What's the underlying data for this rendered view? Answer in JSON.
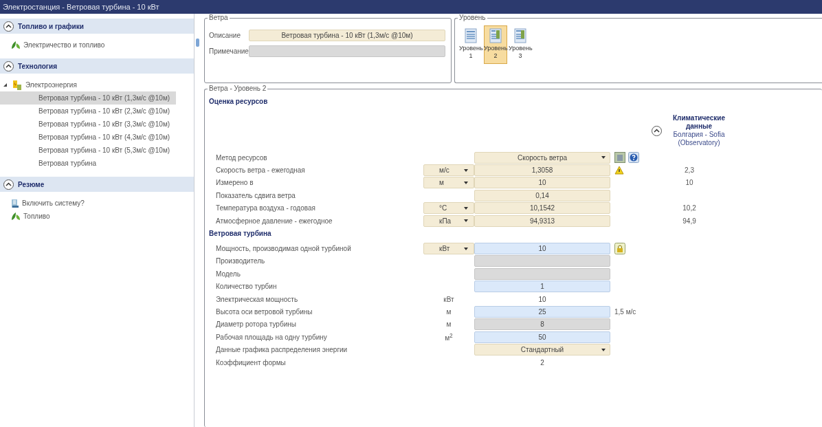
{
  "window": {
    "title": "Электростанция - Ветровая турбина - 10 кВт"
  },
  "sidebar": {
    "sections": [
      {
        "title": "Топливо и графики",
        "expanded": true,
        "items": [
          {
            "label": "Электричество и топливо",
            "kind": "fuel"
          }
        ]
      },
      {
        "title": "Технология",
        "expanded": true,
        "items": [
          {
            "label": "Электроэнергия",
            "kind": "power",
            "expanded": true,
            "children": [
              {
                "label": "Ветровая турбина - 10 кВт (1,3м/с @10м)",
                "selected": true
              },
              {
                "label": "Ветровая турбина - 10 кВт (2,3м/с @10м)",
                "selected": false
              },
              {
                "label": "Ветровая турбина - 10 кВт (3,3м/с @10м)",
                "selected": false
              },
              {
                "label": "Ветровая турбина - 10 кВт (4,3м/с @10м)",
                "selected": false
              },
              {
                "label": "Ветровая турбина - 10 кВт (5,3м/с @10м)",
                "selected": false
              },
              {
                "label": "Ветровая турбина",
                "selected": false
              }
            ]
          }
        ]
      },
      {
        "title": "Резюме",
        "expanded": true,
        "items": [
          {
            "label": "Включить систему?",
            "kind": "system"
          },
          {
            "label": "Топливо",
            "kind": "fuel"
          }
        ]
      }
    ]
  },
  "wind_group": {
    "title": "Ветра",
    "description_label": "Описание",
    "description": "Ветровая турбина - 10 кВт (1,3м/с @10м)",
    "note_label": "Примечание"
  },
  "level_group": {
    "title": "Уровень",
    "levels": [
      {
        "label": "Уровень 1",
        "selected": false
      },
      {
        "label": "Уровень 2",
        "selected": true
      },
      {
        "label": "Уровень 3",
        "selected": false
      }
    ]
  },
  "detail": {
    "title": "Ветра - Уровень 2",
    "climate": {
      "title": "Климатические данные",
      "location": "Болгария - Sofia (Observatory)",
      "expanded": true
    },
    "sections": [
      {
        "title": "Оценка ресурсов",
        "rows": [
          {
            "label": "Метод ресурсов",
            "field": {
              "kind": "select",
              "text": "Скорость ветра"
            },
            "extra": {
              "kind": "tools"
            }
          },
          {
            "label": "Скорость ветра - ежегодная",
            "unit": {
              "kind": "select",
              "text": "м/с"
            },
            "field": {
              "kind": "computed",
              "text": "1,3058"
            },
            "extra": {
              "kind": "warning"
            },
            "climate": "2,3"
          },
          {
            "label": "Измерено в",
            "unit": {
              "kind": "select",
              "text": "м"
            },
            "field": {
              "kind": "computed",
              "text": "10"
            },
            "climate": "10"
          },
          {
            "label": "Показатель сдвига ветра",
            "field": {
              "kind": "computed",
              "text": "0,14"
            }
          },
          {
            "label": "Температура воздуха - годовая",
            "unit": {
              "kind": "select",
              "text": "°C"
            },
            "field": {
              "kind": "computed",
              "text": "10,1542"
            },
            "climate": "10,2"
          },
          {
            "label": "Атмосферное давление - ежегодное",
            "unit": {
              "kind": "select",
              "text": "кПа"
            },
            "field": {
              "kind": "computed",
              "text": "94,9313"
            },
            "climate": "94,9"
          }
        ]
      },
      {
        "title": "Ветровая турбина",
        "rows": [
          {
            "label": "Мощность, производимая одной турбиной",
            "unit": {
              "kind": "select",
              "text": "кВт"
            },
            "field": {
              "kind": "input",
              "text": "10"
            },
            "extra": {
              "kind": "lock"
            }
          },
          {
            "label": "Производитель",
            "field": {
              "kind": "disabled"
            }
          },
          {
            "label": "Модель",
            "field": {
              "kind": "disabled"
            }
          },
          {
            "label": "Количество турбин",
            "field": {
              "kind": "input",
              "text": "1"
            }
          },
          {
            "label": "Электрическая мощность",
            "unit": {
              "kind": "text",
              "text": "кВт"
            },
            "field": {
              "kind": "text",
              "text": "10"
            }
          },
          {
            "label": "Высота оси ветровой турбины",
            "unit": {
              "kind": "text",
              "text": "м"
            },
            "field": {
              "kind": "input",
              "text": "25"
            },
            "extra": {
              "kind": "note",
              "text": "1,5 м/с"
            }
          },
          {
            "label": "Диаметр ротора турбины",
            "unit": {
              "kind": "text",
              "text": "м"
            },
            "field": {
              "kind": "disabled",
              "text": "8"
            }
          },
          {
            "label": "Рабочая площадь на одну турбину",
            "unit": {
              "kind": "text",
              "text": "м$^{2}$"
            },
            "field": {
              "kind": "input",
              "text": "50"
            }
          },
          {
            "label": "Данные графика распределения энергии",
            "field": {
              "kind": "select",
              "text": "Стандартный"
            }
          },
          {
            "label": "Коэффициент формы",
            "field": {
              "kind": "text",
              "text": "2"
            }
          }
        ]
      }
    ]
  }
}
